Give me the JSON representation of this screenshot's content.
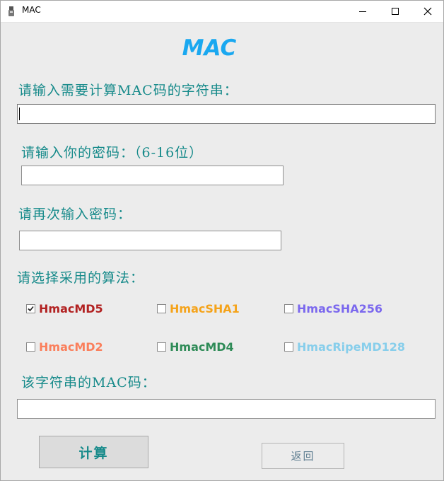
{
  "window": {
    "title": "MAC",
    "icon": "app-icon",
    "controls": [
      "minimize-icon",
      "maximize-icon",
      "close-icon"
    ]
  },
  "heading": "MAC",
  "labels": {
    "input_string": "请输入需要计算MAC码的字符串：",
    "password": "请输入你的密码：（6-16位）",
    "confirm_password": "请再次输入密码：",
    "algorithm": "请选择采用的算法：",
    "mac_result": "该字符串的MAC码："
  },
  "fields": {
    "input_string": {
      "value": "",
      "placeholder": ""
    },
    "password": {
      "value": "",
      "placeholder": ""
    },
    "confirm_password": {
      "value": "",
      "placeholder": ""
    },
    "mac_result": {
      "value": "",
      "placeholder": ""
    }
  },
  "algorithms": [
    {
      "label": "HmacMD5",
      "checked": true,
      "color": "#b22222"
    },
    {
      "label": "HmacSHA1",
      "checked": false,
      "color": "#f5a31a"
    },
    {
      "label": "HmacSHA256",
      "checked": false,
      "color": "#7b68ee"
    },
    {
      "label": "HmacMD2",
      "checked": false,
      "color": "#fa7f5c"
    },
    {
      "label": "HmacMD4",
      "checked": false,
      "color": "#2e8b57"
    },
    {
      "label": "HmacRipeMD128",
      "checked": false,
      "color": "#87ceeb"
    }
  ],
  "buttons": {
    "calculate": "计算",
    "back": "返回"
  },
  "colors": {
    "heading": "#1aa8f0",
    "label": "#168a8a",
    "back_text": "#5f7e91"
  }
}
